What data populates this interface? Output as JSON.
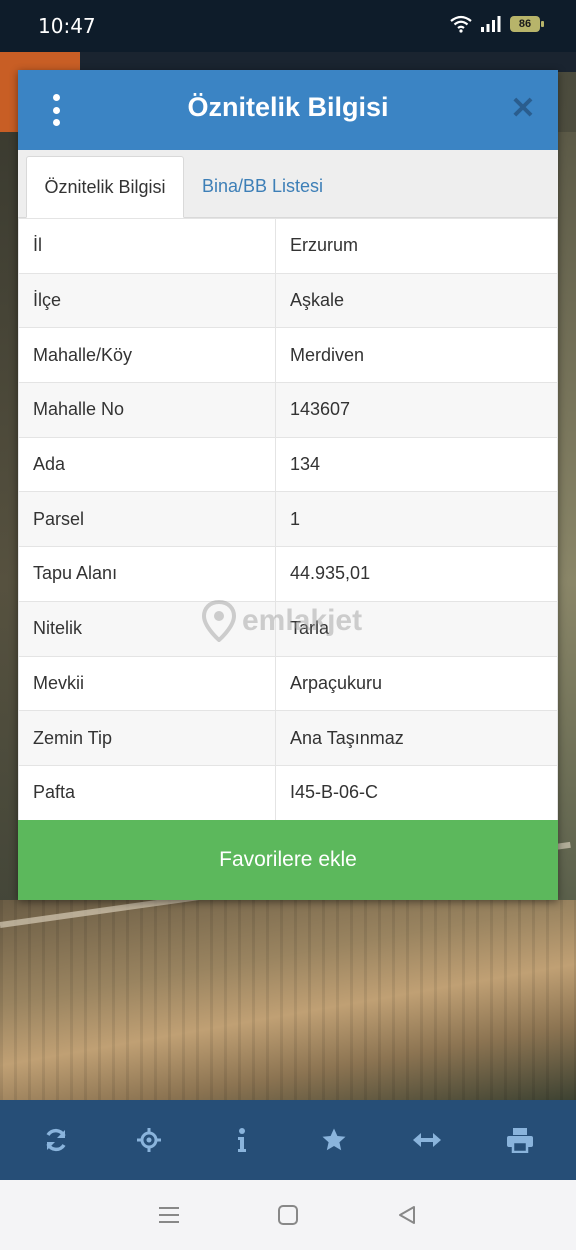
{
  "status_bar": {
    "time": "10:47",
    "battery": "86"
  },
  "modal": {
    "title": "Öznitelik Bilgisi",
    "close_symbol": "✕",
    "tabs": [
      {
        "label": "Öznitelik Bilgisi"
      },
      {
        "label": "Bina/BB Listesi"
      }
    ],
    "rows": [
      {
        "key": "İl",
        "value": "Erzurum"
      },
      {
        "key": "İlçe",
        "value": "Aşkale"
      },
      {
        "key": "Mahalle/Köy",
        "value": "Merdiven"
      },
      {
        "key": "Mahalle No",
        "value": "143607"
      },
      {
        "key": "Ada",
        "value": "134"
      },
      {
        "key": "Parsel",
        "value": "1"
      },
      {
        "key": "Tapu Alanı",
        "value": "44.935,01"
      },
      {
        "key": "Nitelik",
        "value": "Tarla"
      },
      {
        "key": "Mevkii",
        "value": "Arpaçukuru"
      },
      {
        "key": "Zemin Tip",
        "value": "Ana Taşınmaz"
      },
      {
        "key": "Pafta",
        "value": "I45-B-06-C"
      }
    ],
    "favorite_button": "Favorilere ekle"
  },
  "watermark": "emlakjet",
  "toolbar": {
    "icons": [
      "refresh-icon",
      "crosshair-icon",
      "info-icon",
      "star-icon",
      "measure-icon",
      "print-icon"
    ]
  },
  "navbar": {
    "icons": [
      "menu-icon",
      "home-icon",
      "back-icon"
    ]
  },
  "colors": {
    "header": "#3b84c4",
    "favorite": "#5cb85c",
    "toolbar": "#264e77",
    "tab_link": "#3d7fb7"
  }
}
